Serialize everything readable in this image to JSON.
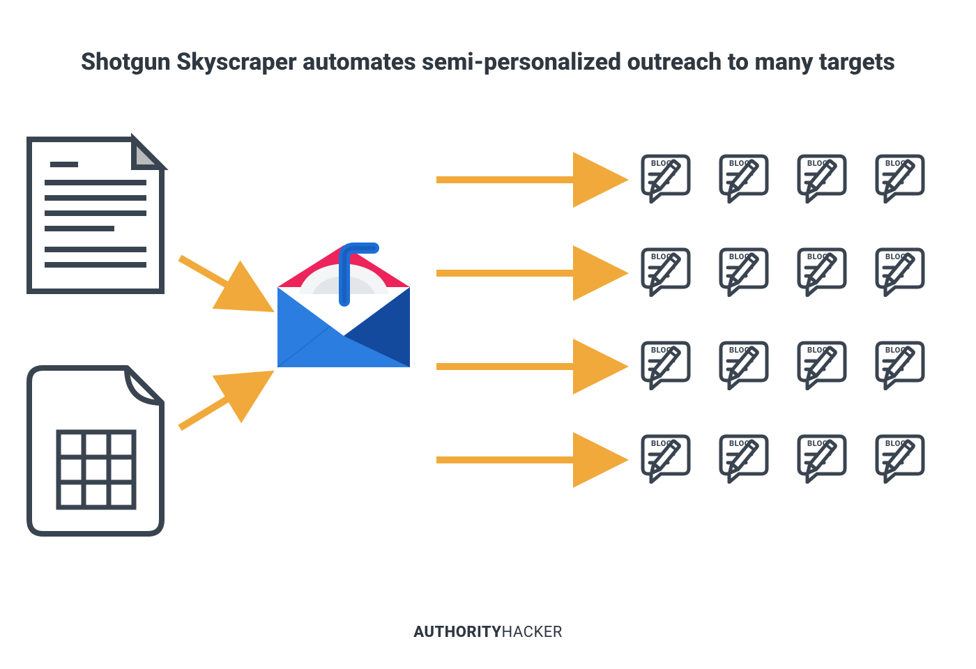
{
  "title": "Shotgun Skyscraper automates semi-personalized outreach to many targets",
  "footer": {
    "bold": "AUTHORITY",
    "thin": "HACKER"
  },
  "blog_label": "BLOG",
  "inputs": [
    "text-document",
    "spreadsheet"
  ],
  "tool": "mailshake-email",
  "output_rows": 4,
  "outputs_per_row": 4,
  "colors": {
    "stroke": "#3a4450",
    "arrow": "#f0a93a",
    "accent_pink": "#ed245b",
    "accent_blue": "#1b6fd6",
    "accent_dark_blue": "#134a9e"
  }
}
